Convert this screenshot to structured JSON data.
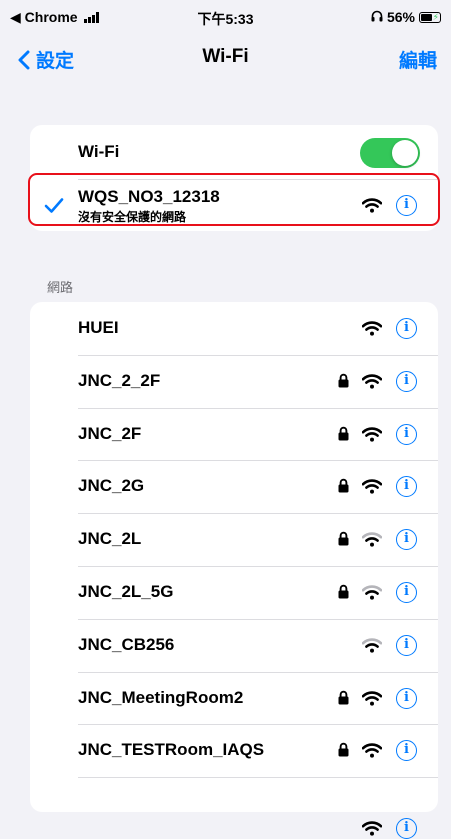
{
  "status_bar": {
    "back_app": "◀ Chrome",
    "time": "下午5:33",
    "battery_text": "56%"
  },
  "nav": {
    "back_label": "設定",
    "title": "Wi-Fi",
    "edit_label": "編輯"
  },
  "wifi_toggle": {
    "label": "Wi-Fi",
    "on": true
  },
  "connected": {
    "name": "WQS_NO3_12318",
    "subtitle": "沒有安全保護的網路"
  },
  "section_label": "網路",
  "networks": [
    {
      "name": "HUEI",
      "locked": false,
      "signal": "strong"
    },
    {
      "name": "JNC_2_2F",
      "locked": true,
      "signal": "strong"
    },
    {
      "name": "JNC_2F",
      "locked": true,
      "signal": "strong"
    },
    {
      "name": "JNC_2G",
      "locked": true,
      "signal": "strong"
    },
    {
      "name": "JNC_2L",
      "locked": true,
      "signal": "weak"
    },
    {
      "name": "JNC_2L_5G",
      "locked": true,
      "signal": "weak"
    },
    {
      "name": "JNC_CB256",
      "locked": false,
      "signal": "weak"
    },
    {
      "name": "JNC_MeetingRoom2",
      "locked": true,
      "signal": "strong"
    },
    {
      "name": "JNC_TESTRoom_IAQS",
      "locked": true,
      "signal": "strong"
    }
  ],
  "colors": {
    "accent": "#007aff",
    "toggle_on": "#34c759",
    "highlight": "#e8101a"
  }
}
